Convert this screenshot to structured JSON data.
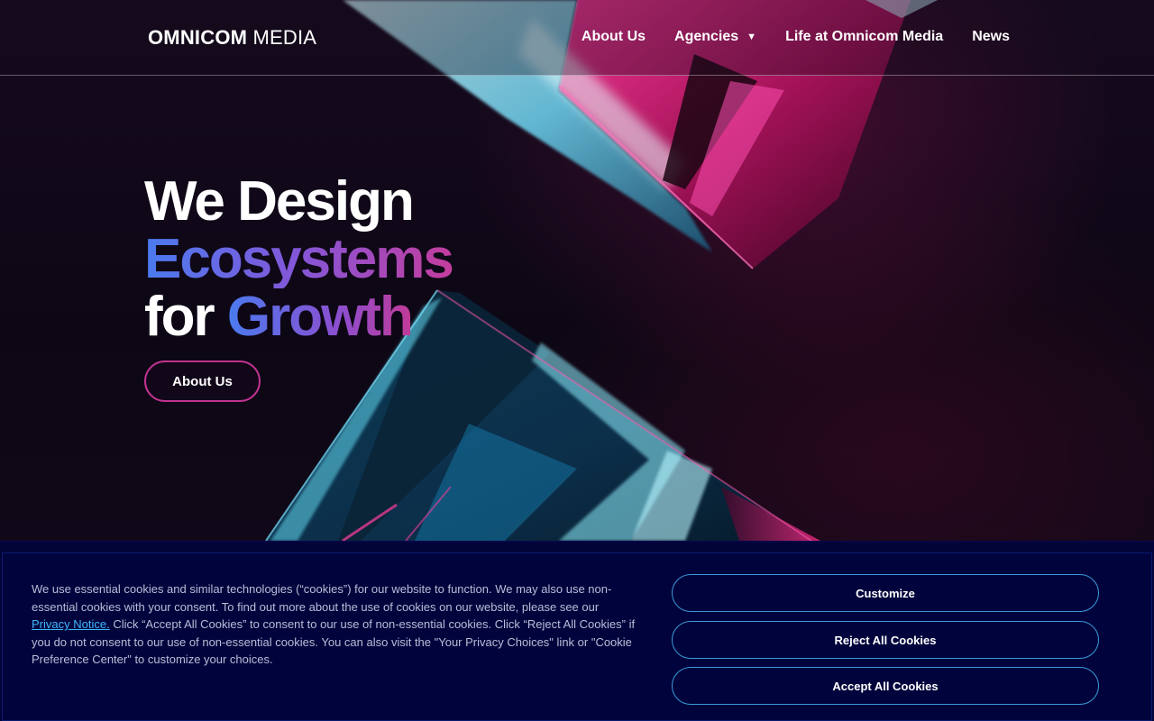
{
  "header": {
    "logo_bold": "OMNICOM",
    "logo_light": "MEDIA",
    "nav": [
      {
        "label": "About Us"
      },
      {
        "label": "Agencies",
        "has_dropdown": true
      },
      {
        "label": "Life at Omnicom Media"
      },
      {
        "label": "News"
      }
    ]
  },
  "hero": {
    "line1": "We Design",
    "line2": "Ecosystems",
    "line3_a": "for",
    "line3_b": "Growth",
    "cta_label": "About Us"
  },
  "cookie_banner": {
    "text_before_link": "We use essential cookies and similar technologies (“cookies”) for our website to function. We may also use non-essential cookies with your consent. To find out more about the use of cookies on our website, please see our",
    "link_label": "Privacy Notice.",
    "text_after_link": "Click “Accept All Cookies” to consent to our use of non-essential cookies. Click “Reject All Cookies” if you do not consent to our use of non-essential cookies. You can also visit the \"Your Privacy Choices\" link or \"Cookie Preference Center\" to customize your choices.",
    "buttons": {
      "customize": "Customize",
      "reject": "Reject All Cookies",
      "accept": "Accept All Cookies"
    }
  },
  "colors": {
    "accent_pink": "#c0338f",
    "accent_blue": "#4a7bf0",
    "banner_bg": "#01043c",
    "link": "#3fb7ff"
  }
}
